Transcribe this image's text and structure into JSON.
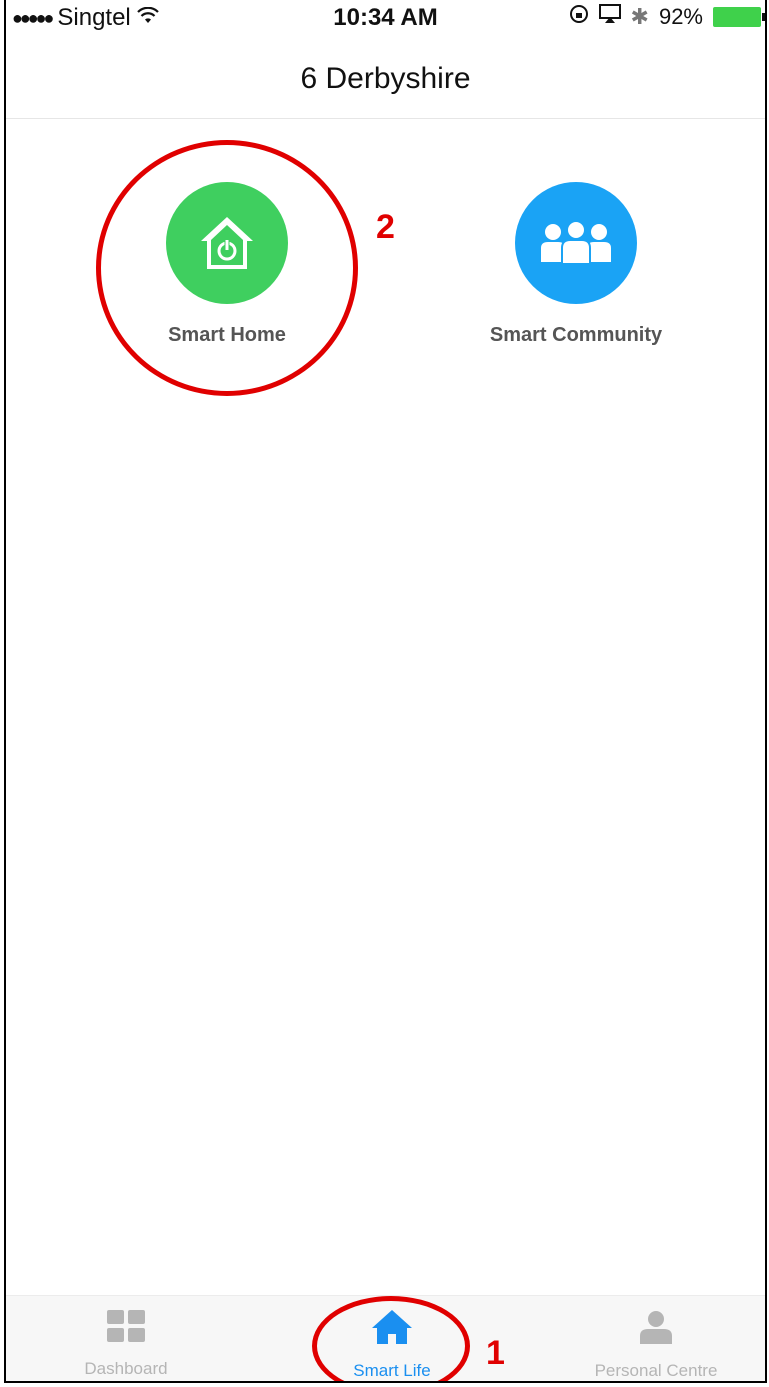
{
  "status_bar": {
    "carrier": "Singtel",
    "time": "10:34 AM",
    "battery": "92%"
  },
  "header": {
    "title": "6 Derbyshire"
  },
  "tiles": [
    {
      "label": "Smart Home",
      "icon": "house-power-icon",
      "color": "#3fcf5f"
    },
    {
      "label": "Smart Community",
      "icon": "people-group-icon",
      "color": "#1aa3f5"
    }
  ],
  "annotations": {
    "step_1": "1",
    "step_2": "2",
    "color": "#e00000"
  },
  "tab_bar": {
    "tabs": [
      {
        "label": "Dashboard",
        "icon": "grid-icon",
        "active": false
      },
      {
        "label": "Smart Life",
        "icon": "home-icon",
        "active": true
      },
      {
        "label": "Personal Centre",
        "icon": "person-icon",
        "active": false
      }
    ],
    "active_color": "#1a8ff0",
    "inactive_color": "#b5b5b5"
  }
}
